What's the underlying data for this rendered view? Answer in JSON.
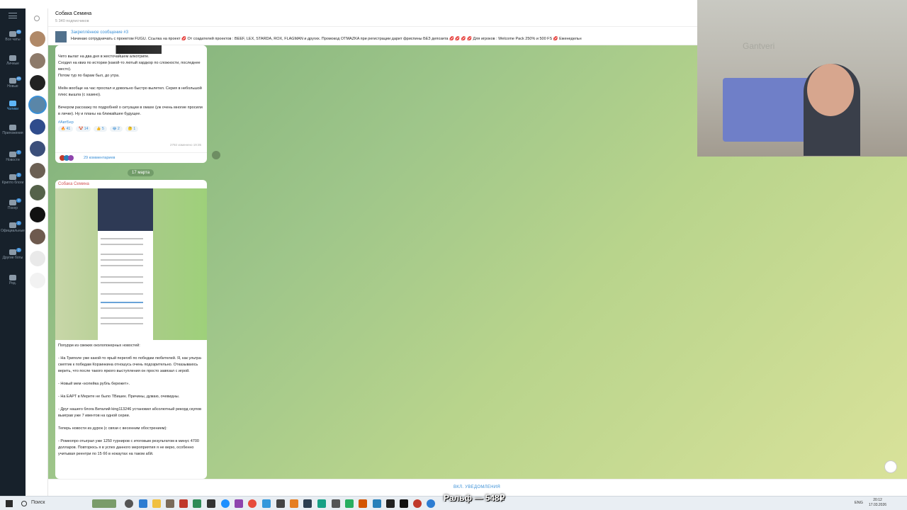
{
  "rail": {
    "items": [
      {
        "label": "Все чаты",
        "badge": "83"
      },
      {
        "label": "Личные",
        "badge": ""
      },
      {
        "label": "Новые",
        "badge": "83"
      },
      {
        "label": "Чатики",
        "badge": ""
      },
      {
        "label": "Приложения",
        "badge": ""
      },
      {
        "label": "Новости",
        "badge": "7"
      },
      {
        "label": "Крипто блоги",
        "badge": "2"
      },
      {
        "label": "Покер",
        "badge": "2"
      },
      {
        "label": "Официальные",
        "badge": "2"
      },
      {
        "label": "Другие боты",
        "badge": "2"
      },
      {
        "label": "Ред.",
        "badge": ""
      }
    ]
  },
  "header": {
    "title": "Собака Семина",
    "subscribers": "5 340 подписчиков"
  },
  "pinned": {
    "title": "Закреплённое сообщение #3",
    "text": "Начинаю сотрудничать с проектом FUGU. Ссылка на проект 💋 От создателей проектов : BEEF, LEX, STARDA, ROX, FLAGMAN и других. Промокод OTMAZKA при регистрации дарит фриспины БЕЗ депозита 💋 💋 💋 💋 Для игроков : Welcome Pack 250% и 500 FS 💋 Еженедельн"
  },
  "message1": {
    "text": "Чето вылат на два дня в жесточайшем алкотрипе.\nСходил на квиз по истории (какой-то лютый хардкор по сложности, последнее место).\nПотом тур по барам был, до утра.\n\nМейн вообще на час проспал и довольно быстро вылетел. Серия в небольшой плюс вышла (с хазино).\n\nВечером расскажу по подробней о ситуации в омахе (уж очень многие просили в личке). Ну и планы на ближайшее будущее.",
    "hashtag": "#АвтБер",
    "reactions": [
      "🔥 41",
      "🤡 14",
      "👍 5",
      "😂 2",
      "🤔 1"
    ],
    "views": "2792",
    "edited": "изменено 19:35",
    "comments": "29 комментариев"
  },
  "date_separator": "17 марта",
  "message2": {
    "author": "Собака Семина",
    "text": "Попурри из свежих околопокерных новостей:\n\n- На Триполе уже какой-то ярый перегиб по победам любителей. Я, как ультра-скептик к победам Корзинкина отношусь очень подозрительно. Отказываюсь верить, что после такого яркого выступления он просто завязал с игрой.\n\n- Новый мем «копейка рубль бережет».\n\n- На EAPT в Мерите не было ТВишек. Причины, думаю, очевидны.\n\n- Друг нашего блога Виталий king113246 установил абсолютный рекорд скупов выиграв уже 7 ивентов на одной серии.\n\nТеперь новости из дурок (с связи с весенним обострением):\n\n- Ромеопро отыграл уже 1250 турниров с итоговым результатом в минус 4700 долларов. Повторюсь я в успех данного мероприятия я не верю, особенно учитывая реентри по 15 бб в нокаутах на таком абй."
  },
  "bottom": {
    "mute_label": "ВКЛ. УВЕДОМЛЕНИЯ"
  },
  "webcam": {
    "brand": "Gantveri"
  },
  "taskbar": {
    "search_label": "Поиск",
    "donation": "Ральф — 548₽",
    "lang": "ENG",
    "time": "20:12",
    "date": "17.03.2026"
  },
  "colors": {
    "rail_bg": "#17212b",
    "accent": "#3a8fd6",
    "author": "#d45757"
  }
}
